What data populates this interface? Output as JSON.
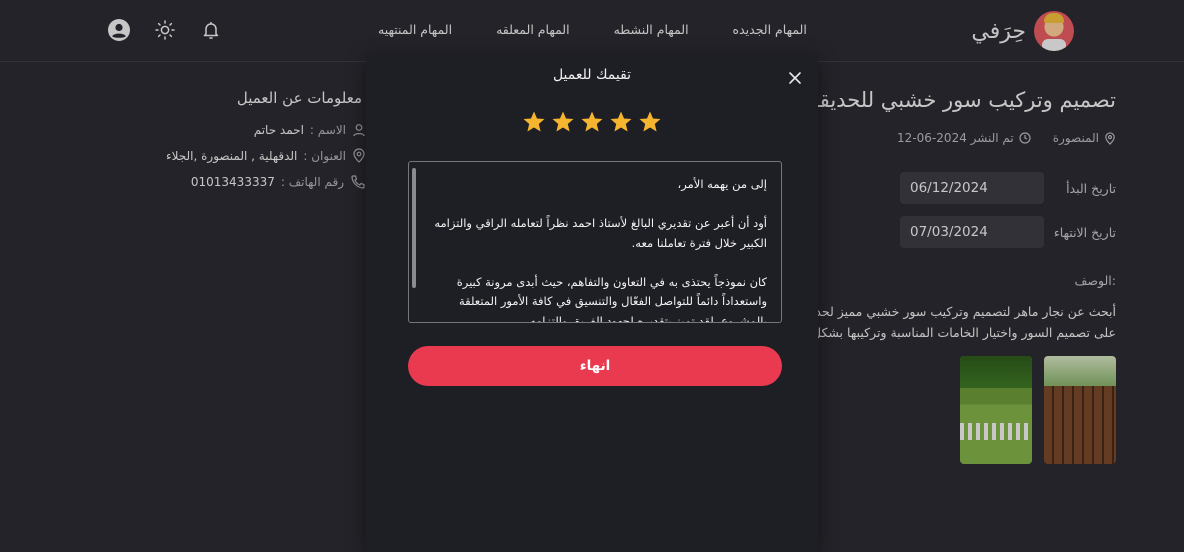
{
  "nav": {
    "brand": "حِرَفي",
    "links": [
      "المهام الجديده",
      "المهام النشطه",
      "المهام المعلقه",
      "المهام المنتهيه"
    ]
  },
  "task": {
    "title": "تصميم وتركيب سور خشبي للحديقة",
    "location": "المنصورة",
    "published": "تم النشر 2024-06-12",
    "start_label": "تاريخ البدأ",
    "start_value": "06/12/2024",
    "end_label": "تاريخ الانتهاء",
    "end_value": "07/03/2024",
    "description_label": "الوصف:",
    "description_lines": [
      "أبحث عن نجار ماهر لتصميم وتركيب سور خشبي مميز لحديقة",
      "على تصميم السور واختيار الخامات المناسبة وتركيبها بشكل"
    ]
  },
  "client": {
    "title": "معلومات عن العميل",
    "name_label": "الاسم :",
    "name_value": "احمد حاتم",
    "address_label": "العنوان :",
    "address_value": "الدقهلية , المنصورة ,الجلاء",
    "phone_label": "رقم الهاتف :",
    "phone_value": "01013433337"
  },
  "modal": {
    "title": "تقيمك للعميل",
    "rating": 5,
    "rating_max": 5,
    "review": "إلى من يهمه الأمر،\n\nأود أن أعبر عن تقديري البالغ لأستاذ احمد نظراً لتعامله الراقي والتزامه الكبير خلال فترة تعاملنا معه.\n\nكان  نموذجاً يحتذى به في التعاون والتفاهم، حيث أبدى مرونة كبيرة واستعداداً دائماً للتواصل الفعّال والتنسيق في كافة الأمور المتعلقة بالمشروع. لقد تميز بتقديره لجهود الفريق والتزامه",
    "finish_label": "انهاء"
  },
  "colors": {
    "accent": "#ea3a50",
    "star": "#f5b52e",
    "background": "#2b2b32",
    "modal": "#1e1e25"
  }
}
